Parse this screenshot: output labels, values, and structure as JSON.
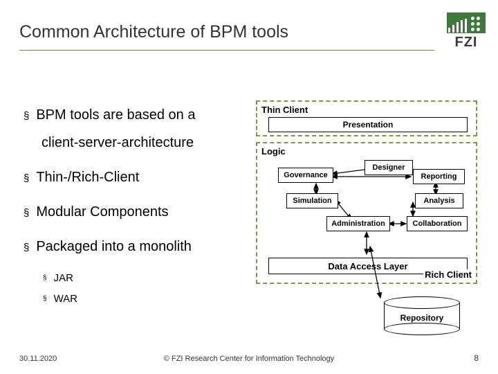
{
  "title": "Common Architecture of BPM tools",
  "logo": {
    "text": "FZI"
  },
  "bullets": {
    "b1": "BPM tools are based on a",
    "b1_cont": "client-server-architecture",
    "b2": "Thin-/Rich-Client",
    "b3": "Modular Components",
    "b4": "Packaged into a monolith",
    "sub1": "JAR",
    "sub2": "WAR"
  },
  "marker": "§",
  "diagram": {
    "thin_client": "Thin Client",
    "presentation": "Presentation",
    "logic": "Logic",
    "components": {
      "governance": "Governance",
      "designer": "Designer",
      "reporting": "Reporting",
      "simulation": "Simulation",
      "analysis": "Analysis",
      "administration": "Administration",
      "collaboration": "Collaboration"
    },
    "dal": "Data Access Layer",
    "rich_client": "Rich Client",
    "repository": "Repository"
  },
  "footer": {
    "date": "30.11.2020",
    "copyright": "© FZI Research Center for Information Technology",
    "page": "8"
  }
}
